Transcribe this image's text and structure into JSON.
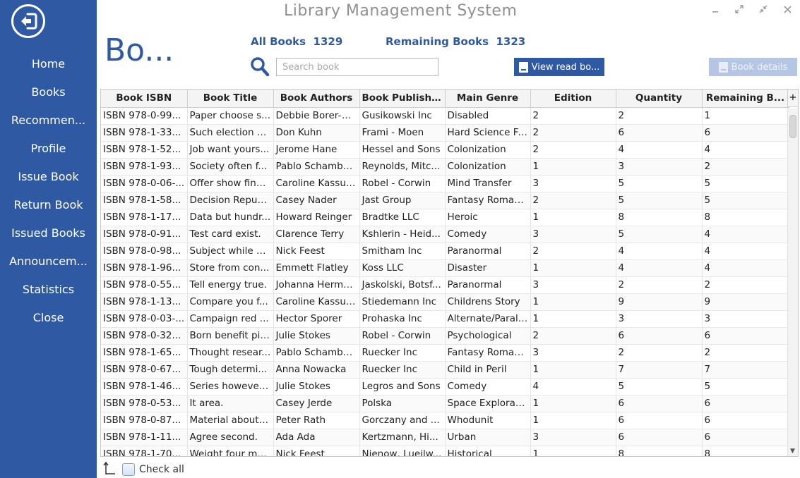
{
  "app": {
    "title": "Library Management System"
  },
  "sidebar": {
    "items": [
      {
        "label": "Home"
      },
      {
        "label": "Books"
      },
      {
        "label": "Recommen..."
      },
      {
        "label": "Profile"
      },
      {
        "label": "Issue Book"
      },
      {
        "label": "Return Book"
      },
      {
        "label": "Issued Books"
      },
      {
        "label": "Announcem..."
      },
      {
        "label": "Statistics"
      },
      {
        "label": "Close"
      }
    ]
  },
  "header": {
    "page_title": "Bo...",
    "all_books_label": "All Books",
    "all_books_count": "1329",
    "remaining_books_label": "Remaining Books",
    "remaining_books_count": "1323",
    "search_placeholder": "Search book",
    "view_button": "View read bo...",
    "details_button": "Book details"
  },
  "table": {
    "columns": [
      "Book ISBN",
      "Book Title",
      "Book Authors",
      "Book Publisher",
      "Main Genre",
      "Edition",
      "Quantity",
      "Remaining B..."
    ],
    "rows": [
      [
        "ISBN 978-0-99...",
        "Paper choose s...",
        "Debbie Borer-G...",
        "Gusikowski Inc",
        "Disabled",
        "2",
        "2",
        "1"
      ],
      [
        "ISBN 978-1-33...",
        "Such election c...",
        "Don Kuhn",
        "Frami - Moen",
        "Hard Science Fi...",
        "2",
        "6",
        "6"
      ],
      [
        "ISBN 978-1-52...",
        "Job want yours...",
        "Jerome Hane",
        "Hessel and Sons",
        "Colonization",
        "2",
        "4",
        "4"
      ],
      [
        "ISBN 978-1-93...",
        "Society often f...",
        "Pablo Schambe...",
        "Reynolds, Mitc...",
        "Colonization",
        "1",
        "3",
        "2"
      ],
      [
        "ISBN 978-0-06-...",
        "Offer show fina...",
        "Caroline Kassulke",
        "Robel - Corwin",
        "Mind Transfer",
        "3",
        "5",
        "5"
      ],
      [
        "ISBN 978-1-58...",
        "Decision Repub...",
        "Casey Nader",
        "Jast Group",
        "Fantasy Roman...",
        "2",
        "5",
        "5"
      ],
      [
        "ISBN 978-1-17...",
        "Data but hundr...",
        "Howard Reinger",
        "Bradtke LLC",
        "Heroic",
        "1",
        "8",
        "8"
      ],
      [
        "ISBN 978-0-91...",
        "Test card exist.",
        "Clarence Terry",
        "Kshlerin - Heid...",
        "Comedy",
        "3",
        "5",
        "4"
      ],
      [
        "ISBN 978-0-98...",
        "Subject while b...",
        "Nick Feest",
        "Smitham Inc",
        "Paranormal",
        "2",
        "4",
        "4"
      ],
      [
        "ISBN 978-1-96...",
        "Store from con...",
        "Emmett Flatley",
        "Koss LLC",
        "Disaster",
        "1",
        "4",
        "4"
      ],
      [
        "ISBN 978-0-55...",
        "Tell energy true.",
        "Johanna Herma...",
        "Jaskolski, Botsf...",
        "Paranormal",
        "3",
        "2",
        "2"
      ],
      [
        "ISBN 978-1-13...",
        "Compare you f...",
        "Caroline Kassulke",
        "Stiedemann Inc",
        "Childrens Story",
        "1",
        "9",
        "9"
      ],
      [
        "ISBN 978-0-03-...",
        "Campaign red ...",
        "Hector Sporer",
        "Prohaska Inc",
        "Alternate/Parall...",
        "1",
        "3",
        "3"
      ],
      [
        "ISBN 978-0-32...",
        "Born benefit pick.",
        "Julie Stokes",
        "Robel - Corwin",
        "Psychological",
        "2",
        "6",
        "6"
      ],
      [
        "ISBN 978-1-65...",
        "Thought resear...",
        "Pablo Schambe...",
        "Ruecker Inc",
        "Fantasy Roman...",
        "3",
        "2",
        "2"
      ],
      [
        "ISBN 978-0-67...",
        "Tough determi...",
        "Anna Nowacka",
        "Ruecker Inc",
        "Child in Peril",
        "1",
        "7",
        "7"
      ],
      [
        "ISBN 978-1-46...",
        "Series however...",
        "Julie Stokes",
        "Legros and Sons",
        "Comedy",
        "4",
        "5",
        "5"
      ],
      [
        "ISBN 978-0-53...",
        "It area.",
        "Casey Jerde",
        "Polska",
        "Space Explorati...",
        "1",
        "6",
        "6"
      ],
      [
        "ISBN 978-0-87...",
        "Material about ...",
        "Peter Rath",
        "Gorczany and ...",
        "Whodunit",
        "1",
        "6",
        "6"
      ],
      [
        "ISBN 978-1-11...",
        "Agree second.",
        "Ada Ada",
        "Kertzmann, Hi...",
        "Urban",
        "3",
        "6",
        "6"
      ],
      [
        "ISBN 978-1-70...",
        "Weight four mo...",
        "Nick Feest",
        "Nienow, Lueilw...",
        "Historical",
        "1",
        "8",
        "8"
      ]
    ],
    "add_column_symbol": "+"
  },
  "footer": {
    "check_all_label": "Check all"
  },
  "colors": {
    "accent": "#2f5aa3",
    "disabled_button": "#b4c6e3"
  }
}
